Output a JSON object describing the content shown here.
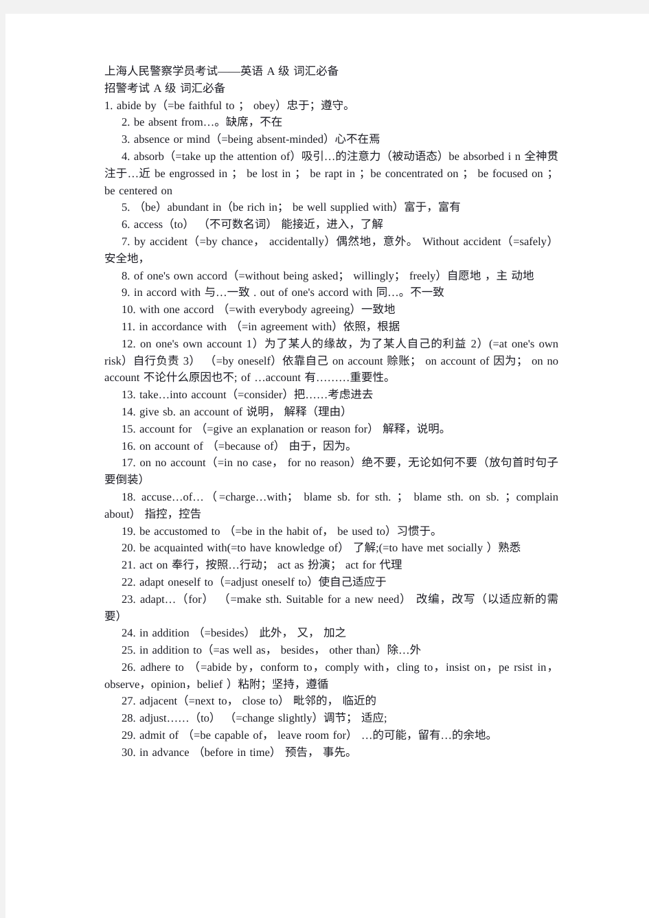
{
  "document": {
    "title_line": "上海人民警察学员考试——英语 A 级  词汇必备",
    "subtitle_line": "招警考试 A 级  词汇必备",
    "entries": [
      "1. abide by（=be faithful to ；  obey）忠于；遵守。",
      "2. be absent from…。缺席，不在",
      "3. absence or mind（=being absent-minded）心不在焉",
      "4. absorb（=take up the attention of）吸引…的注意力（被动语态）be absorbed i n 全神贯注于…近 be engrossed in ；  be lost in ；  be rapt in ；be concentrated on ；  be focused on ；  be centered on",
      "5. （be）abundant in（be rich in；  be well supplied with）富于，富有",
      "6. access（to） （不可数名词） 能接近，进入，了解",
      "7. by accident（=by chance， accidentally）偶然地，意外。 Without accident（=safely） 安全地，",
      "8. of one's own accord（=without being asked；  willingly；  freely）自愿地 ，主 动地",
      "9. in accord with 与…一致 . out of one's accord with 同…。不一致",
      "10. with one accord （=with everybody agreeing）一致地",
      "11. in accordance with （=in agreement with）依照，根据",
      "12. on one's own account 1）为了某人的缘故，为了某人自己的利益 2）(=at one's own risk）自行负责 3） （=by oneself）依靠自己 on account 赊账； on account of 因为； on no account 不论什么原因也不; of …account 有………重要性。",
      "13. take…into account（=consider）把……考虑进去",
      "14. give sb. an account of 说明， 解释（理由）",
      "15. account for （=give an explanation or reason for） 解释，说明。",
      "16. on account of （=because of） 由于，因为。",
      "17. on no account（=in no case， for no reason）绝不要，无论如何不要（放句首时句子要倒装）",
      "18. accuse…of…（=charge…with；  blame sb. for sth. ；  blame sth. on sb. ；complain about） 指控，控告",
      "19. be accustomed to （=be in the habit of， be used to）习惯于。",
      "20. be acquainted with(=to have knowledge of） 了解;(=to have met socially ）熟悉",
      "21. act on 奉行，按照…行动； act as 扮演； act for 代理",
      "22. adapt oneself to（=adjust oneself to）使自己适应于",
      "23. adapt…（for） （=make sth. Suitable for a new need） 改编，改写（以适应新的需要）",
      "24. in addition （=besides） 此外， 又， 加之",
      "25. in addition to（=as well as， besides， other than）除…外",
      "26. adhere to （=abide by，conform to，comply with，cling to，insist on，pe rsist in，observe，opinion，belief ）粘附；坚持，遵循",
      "27. adjacent（=next to， close to） 毗邻的， 临近的",
      "28. adjust……（to） （=change slightly）调节； 适应;",
      "29. admit of （=be capable of， leave room for） …的可能，留有…的余地。",
      "30. in advance （before in time） 预告， 事先。"
    ]
  }
}
